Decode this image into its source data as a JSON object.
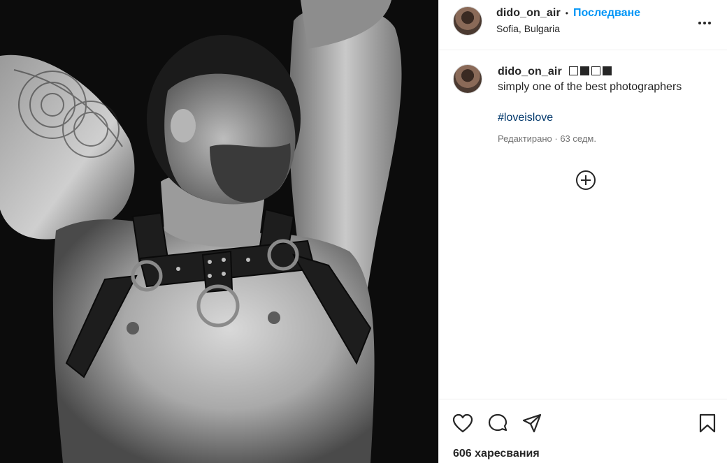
{
  "post": {
    "username": "dido_on_air",
    "follow_label": "Последване",
    "separator": "•",
    "location": "Sofia, Bulgaria"
  },
  "caption": {
    "username": "dido_on_air",
    "squares": [
      "empty",
      "full",
      "empty",
      "full"
    ],
    "text": "simply one of the best photographers",
    "hashtag": "#loveislove",
    "meta": "Редактирано · 63 седм."
  },
  "actions": {
    "icons": [
      "heart-icon",
      "comment-icon",
      "share-icon",
      "bookmark-icon"
    ],
    "likes": "606 харесвания"
  },
  "photo": {
    "description_icon": "black-and-white-portrait-photo"
  }
}
